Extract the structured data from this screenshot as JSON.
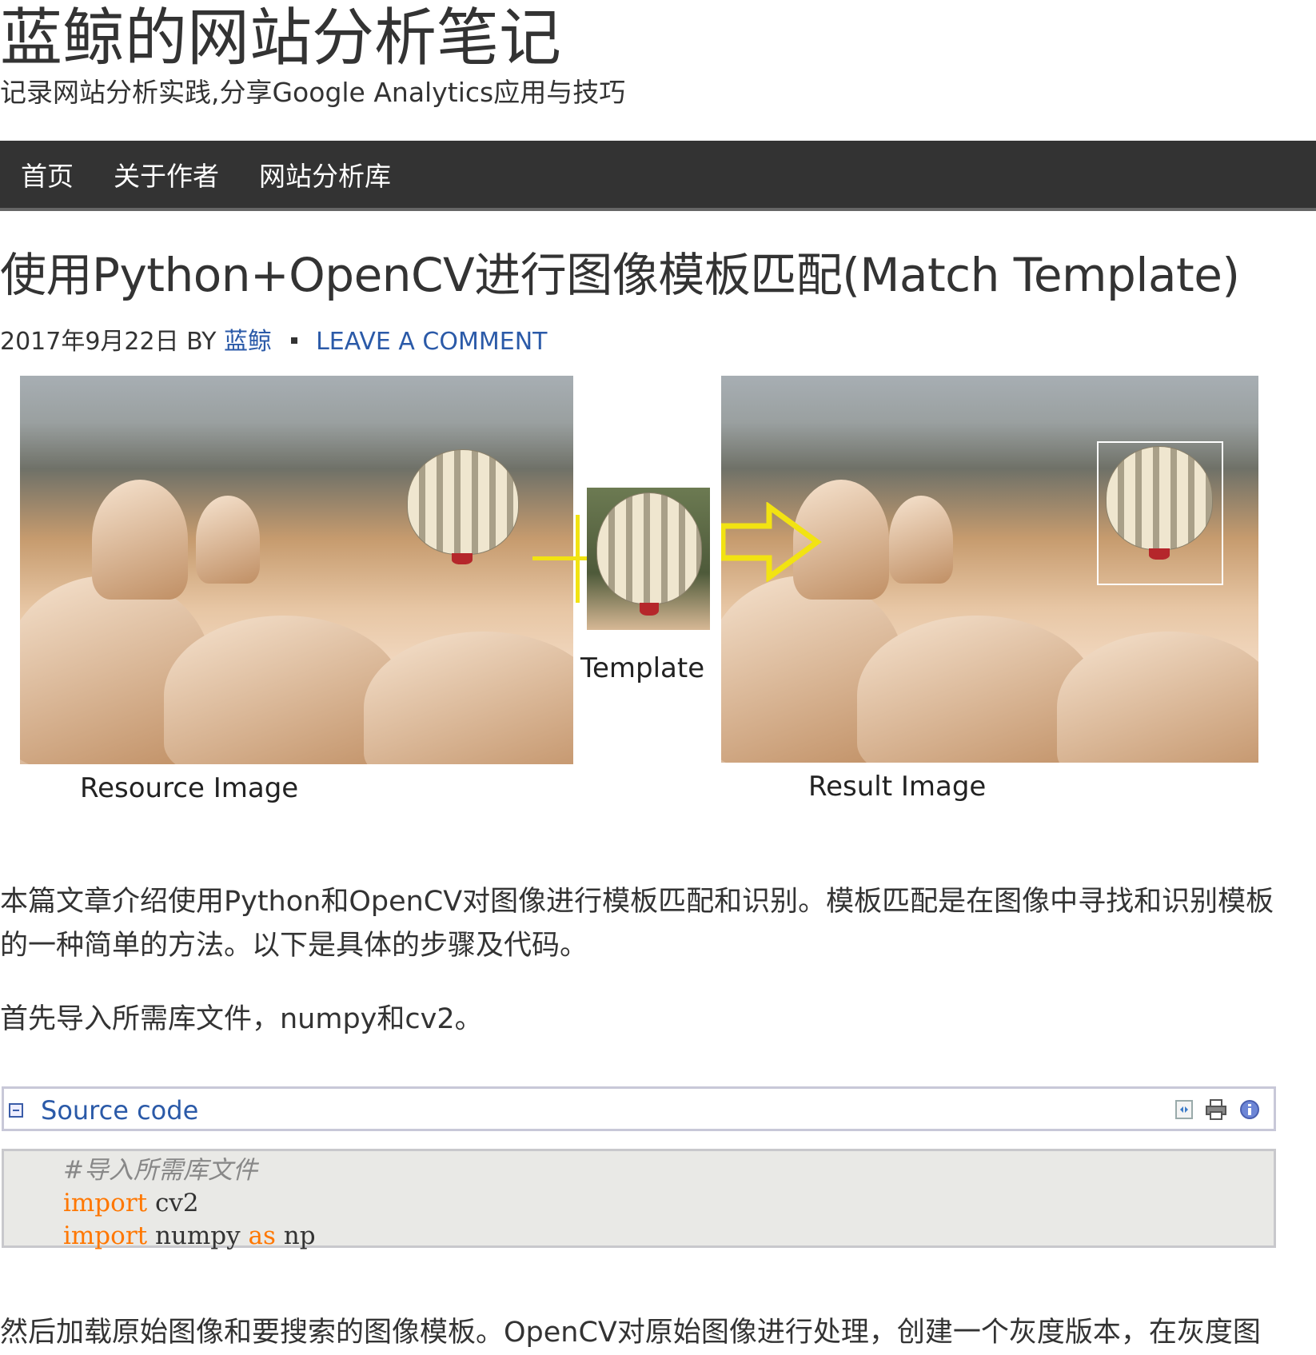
{
  "site": {
    "title": "蓝鲸的网站分析笔记",
    "description": "记录网站分析实践,分享Google Analytics应用与技巧"
  },
  "nav": {
    "items": [
      "首页",
      "关于作者",
      "网站分析库"
    ]
  },
  "post": {
    "title": "使用Python+OpenCV进行图像模板匹配(Match Template)",
    "date": "2017年9月22日",
    "by": "BY",
    "author": "蓝鲸",
    "comment_link": "LEAVE A COMMENT"
  },
  "figure": {
    "resource_caption": "Resource Image",
    "template_caption": "Template",
    "result_caption": "Result Image"
  },
  "body": {
    "para1": "本篇文章介绍使用Python和OpenCV对图像进行模板匹配和识别。模板匹配是在图像中寻找和识别模板的一种简单的方法。以下是具体的步骤及代码。",
    "para2": "首先导入所需库文件，numpy和cv2。",
    "para3": "然后加载原始图像和要搜索的图像模板。OpenCV对原始图像进行处理，创建一个灰度版本，在灰度图"
  },
  "code": {
    "header_label": "Source code",
    "tools": [
      "view-source-icon",
      "print-icon",
      "info-icon"
    ],
    "lines": [
      {
        "comment": "#导入所需库文件"
      },
      {
        "kw": "import",
        "rest": " cv2"
      },
      {
        "kw": "import",
        "mid": " numpy ",
        "kw2": "as",
        "rest": " np"
      }
    ]
  },
  "colors": {
    "nav_bg": "#333333",
    "link": "#2b5aa8",
    "keyword": "#ff7700",
    "arrow": "#f2e312"
  }
}
